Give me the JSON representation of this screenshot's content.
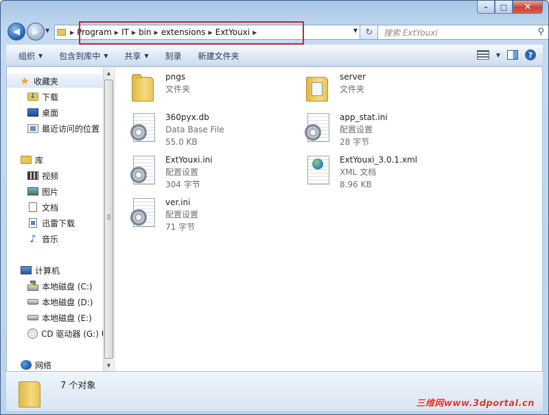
{
  "window": {
    "caption": {
      "minimize": "–",
      "maximize": "□",
      "close": "✕"
    }
  },
  "address": {
    "crumbs": [
      "Program",
      "IT",
      "bin",
      "extensions",
      "ExtYouxi"
    ]
  },
  "search": {
    "placeholder": "搜索 ExtYouxi"
  },
  "toolbar": {
    "organize": "组织",
    "include_library": "包含到库中",
    "share": "共享",
    "burn": "刻录",
    "new_folder": "新建文件夹"
  },
  "sidebar": {
    "favorites": "收藏夹",
    "downloads": "下载",
    "desktop": "桌面",
    "recent": "最近访问的位置",
    "libraries": "库",
    "videos": "视频",
    "pictures": "图片",
    "documents": "文档",
    "thunder": "迅雷下载",
    "music": "音乐",
    "computer": "计算机",
    "drive_c": "本地磁盘 (C:)",
    "drive_d": "本地磁盘 (D:)",
    "drive_e": "本地磁盘 (E:)",
    "drive_cd": "CD 驱动器 (G:) U",
    "network": "网络"
  },
  "files": [
    {
      "name": "pngs",
      "type": "文件夹",
      "size": "",
      "icon": "folder"
    },
    {
      "name": "server",
      "type": "文件夹",
      "size": "",
      "icon": "folder-srv"
    },
    {
      "name": "360pyx.db",
      "type": "Data Base File",
      "size": "55.0 KB",
      "icon": "settings"
    },
    {
      "name": "app_stat.ini",
      "type": "配置设置",
      "size": "28 字节",
      "icon": "settings"
    },
    {
      "name": "ExtYouxi.ini",
      "type": "配置设置",
      "size": "304 字节",
      "icon": "settings"
    },
    {
      "name": "ExtYouxi_3.0.1.xml",
      "type": "XML 文档",
      "size": "8.96 KB",
      "icon": "xml"
    },
    {
      "name": "ver.ini",
      "type": "配置设置",
      "size": "71 字节",
      "icon": "settings"
    }
  ],
  "status": {
    "count": "7 个对象"
  },
  "watermark": "三维网www.3dportal.cn",
  "colors": {
    "highlight_box": "#d0201f",
    "accent": "#2e66b6"
  }
}
